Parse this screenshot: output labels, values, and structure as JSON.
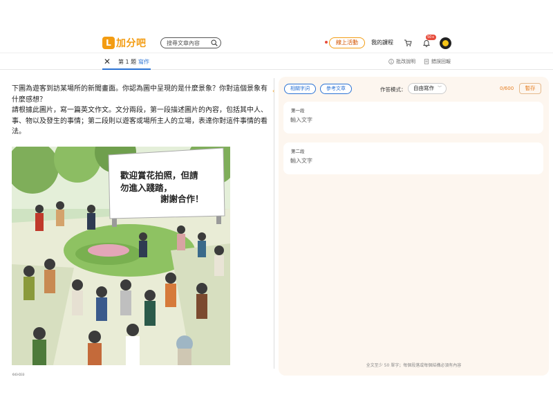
{
  "header": {
    "logo_mark": "L",
    "logo_text": "加分吧",
    "search_placeholder": "搜尋文章內容",
    "activity_label": "線上活動",
    "courses_label": "我的課程",
    "notification_badge": "50+"
  },
  "subbar": {
    "question_number": "第 1 題",
    "question_type": "寫作",
    "info_label": "批改說明",
    "report_label": "錯誤回報"
  },
  "question": {
    "prompt_line1": "下圖為遊客到訪某場所的新聞畫面。你認為圖中呈現的是什麼景象？你對這個景象有什麼感想？",
    "prompt_line2": "請根據此圖片，寫一篇英文作文。文分兩段，第一段描述圖片的內容，包括其中人、事、物以及發生的事情；第二段則以遊客或場所主人的立場，表達你對這件事情的看法。",
    "sign_text": "歡迎賞花拍照，但請勿進入踐踏，謝謝合作！",
    "image_credit": "643-D33"
  },
  "editor": {
    "related_words_label": "相關字詞",
    "reference_label": "參考文章",
    "mode_label": "作答模式：",
    "mode_value": "自由寫作",
    "char_count": "0/600",
    "save_label": "暫存",
    "paragraphs": [
      {
        "title": "第一段",
        "placeholder": "輸入文字"
      },
      {
        "title": "第二段",
        "placeholder": "輸入文字"
      }
    ],
    "footnote": "全文至少 50 單字；每個段落或每個結構必須有內容"
  },
  "colors": {
    "brand_orange": "#f39c12",
    "accent_blue": "#2a72d4",
    "panel_bg": "#fdf6ef"
  }
}
